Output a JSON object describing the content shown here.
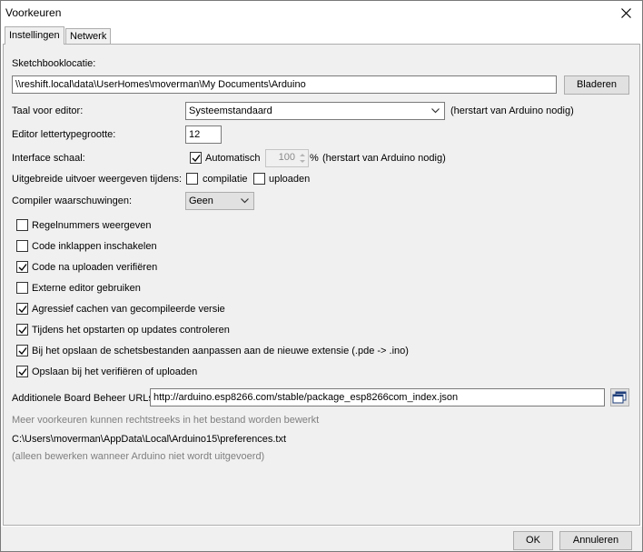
{
  "window": {
    "title": "Voorkeuren"
  },
  "tabs": [
    {
      "label": "Instellingen"
    },
    {
      "label": "Netwerk"
    }
  ],
  "sketchbook": {
    "label": "Sketchbooklocatie:",
    "path": "\\\\reshift.local\\data\\UserHomes\\moverman\\My Documents\\Arduino",
    "browse_label": "Bladeren"
  },
  "language": {
    "label": "Taal voor editor:",
    "value": "Systeemstandaard",
    "note": "(herstart van Arduino nodig)"
  },
  "font_size": {
    "label": "Editor lettertypegrootte:",
    "value": "12"
  },
  "interface_scale": {
    "label": "Interface schaal:",
    "auto_label": "Automatisch",
    "auto_checked": true,
    "value": "100",
    "unit": "%",
    "note": "(herstart van Arduino nodig)"
  },
  "verbose": {
    "label": "Uitgebreide uitvoer weergeven tijdens:",
    "compile_label": "compilatie",
    "upload_label": "uploaden"
  },
  "compiler_warnings": {
    "label": "Compiler waarschuwingen:",
    "value": "Geen"
  },
  "options": [
    {
      "label": "Regelnummers weergeven",
      "checked": false
    },
    {
      "label": "Code inklappen inschakelen",
      "checked": false
    },
    {
      "label": "Code na uploaden verifiëren",
      "checked": true
    },
    {
      "label": "Externe editor gebruiken",
      "checked": false
    },
    {
      "label": "Agressief cachen van gecompileerde versie",
      "checked": true
    },
    {
      "label": "Tijdens het opstarten op updates controleren",
      "checked": true
    },
    {
      "label": "Bij het opslaan de schetsbestanden aanpassen aan de nieuwe extensie (.pde -> .ino)",
      "checked": true
    },
    {
      "label": "Opslaan bij het verifiëren of uploaden",
      "checked": true
    }
  ],
  "board_urls": {
    "label": "Additionele Board Beheer URLs",
    "value": "http://arduino.esp8266.com/stable/package_esp8266com_index.json"
  },
  "more_prefs_note": "Meer voorkeuren kunnen rechtstreeks in het bestand worden bewerkt",
  "prefs_path": "C:\\Users\\moverman\\AppData\\Local\\Arduino15\\preferences.txt",
  "edit_note": "(alleen bewerken wanneer Arduino niet wordt uitgevoerd)",
  "footer": {
    "ok_label": "OK",
    "cancel_label": "Annuleren"
  }
}
